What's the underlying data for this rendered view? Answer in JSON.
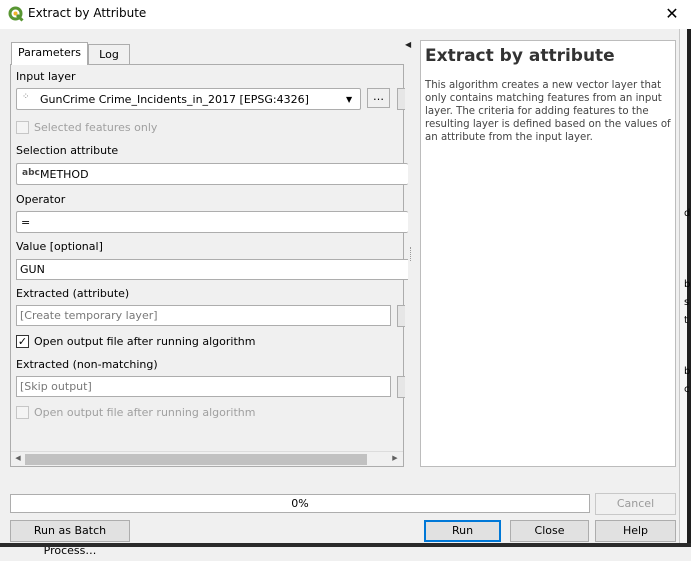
{
  "window": {
    "title": "Extract by Attribute",
    "close_glyph": "✕"
  },
  "tabs": [
    {
      "label": "Parameters"
    },
    {
      "label": "Log"
    }
  ],
  "form": {
    "input_layer_label": "Input layer",
    "input_layer_value": "GunCrime Crime_Incidents_in_2017 [EPSG:4326]",
    "browse_label": "…",
    "selected_features_label": "Selected features only",
    "selection_attribute_label": "Selection attribute",
    "selection_attribute_type": "abc",
    "selection_attribute_value": "METHOD",
    "operator_label": "Operator",
    "operator_value": "=",
    "value_label": "Value [optional]",
    "value_value": "GUN",
    "extracted_attr_label": "Extracted (attribute)",
    "extracted_attr_placeholder": "[Create temporary layer]",
    "open_output_label": "Open output file after running algorithm",
    "open_output_checked": "✓",
    "extracted_nonmatch_label": "Extracted (non-matching)",
    "extracted_nonmatch_placeholder": "[Skip output]",
    "open_output2_label": "Open output file after running algorithm"
  },
  "help": {
    "title": "Extract by attribute",
    "body": "This algorithm creates a new vector layer that only contains matching features from an input layer. The criteria for adding features to the resulting layer is defined based on the values of an attribute from the input layer."
  },
  "progress": {
    "text": "0%",
    "fraction": 0
  },
  "buttons": {
    "cancel": "Cancel",
    "batch": "Run as Batch Process…",
    "run": "Run",
    "close": "Close",
    "help": "Help"
  },
  "edge_glyphs": [
    "d",
    "b",
    "s",
    "t",
    "b",
    "c"
  ],
  "colors": {
    "accent": "#0078d7",
    "qgis_green": "#589632"
  }
}
